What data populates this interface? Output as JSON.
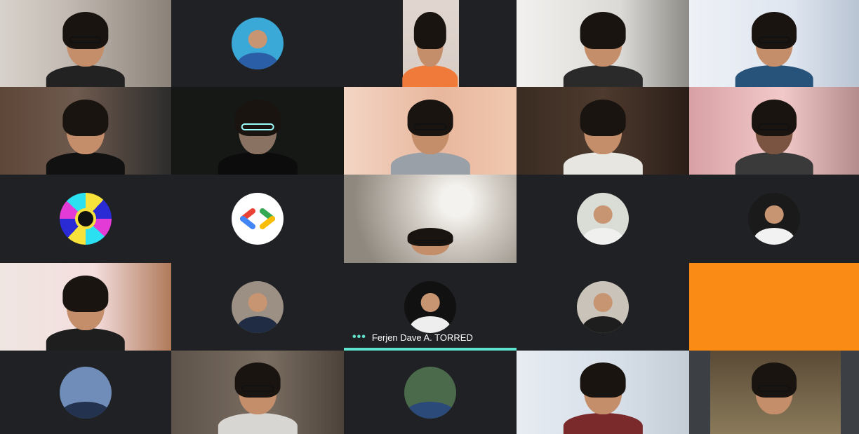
{
  "meeting": {
    "active_speaker": "Ferjen Dave A. TORRED",
    "speaking_indicator": "•••"
  },
  "colors": {
    "background": "#202124",
    "speaker_accent": "#5fe3cc",
    "orange_tile": "#fa8c16"
  },
  "tiles": [
    {
      "kind": "video"
    },
    {
      "kind": "avatar"
    },
    {
      "kind": "video"
    },
    {
      "kind": "video"
    },
    {
      "kind": "video"
    },
    {
      "kind": "video"
    },
    {
      "kind": "video"
    },
    {
      "kind": "video"
    },
    {
      "kind": "video"
    },
    {
      "kind": "video"
    },
    {
      "kind": "avatar-mandala"
    },
    {
      "kind": "avatar-logo"
    },
    {
      "kind": "video"
    },
    {
      "kind": "avatar"
    },
    {
      "kind": "avatar"
    },
    {
      "kind": "video"
    },
    {
      "kind": "avatar"
    },
    {
      "kind": "avatar-speaking"
    },
    {
      "kind": "avatar"
    },
    {
      "kind": "orange"
    },
    {
      "kind": "avatar"
    },
    {
      "kind": "video"
    },
    {
      "kind": "avatar"
    },
    {
      "kind": "video"
    },
    {
      "kind": "video"
    }
  ]
}
